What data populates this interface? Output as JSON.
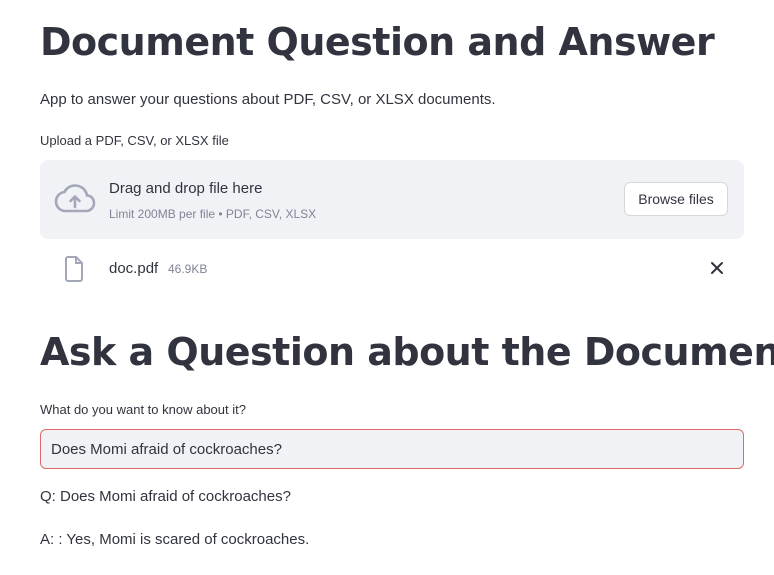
{
  "header": {
    "title": "Document Question and Answer",
    "subtitle": "App to answer your questions about PDF, CSV, or XLSX documents."
  },
  "uploader": {
    "label": "Upload a PDF, CSV, or XLSX file",
    "drag_text": "Drag and drop file here",
    "limit_text": "Limit 200MB per file • PDF, CSV, XLSX",
    "browse_label": "Browse files",
    "icon": "cloud-upload-icon"
  },
  "uploaded_file": {
    "name": "doc.pdf",
    "size": "46.9KB",
    "icon": "file-icon",
    "remove_icon": "close-icon"
  },
  "question_section": {
    "title": "Ask a Question about the Document",
    "input_label": "What do you want to know about it?",
    "input_value": "Does Momi afraid of cockroaches?",
    "question_line": "Q: Does Momi afraid of cockroaches?",
    "answer_line": "A: : Yes, Momi is scared of cockroaches."
  },
  "colors": {
    "text": "#31333f",
    "muted": "#808495",
    "panel": "#f0f2f6",
    "input_border_focus": "#e06a6a"
  }
}
